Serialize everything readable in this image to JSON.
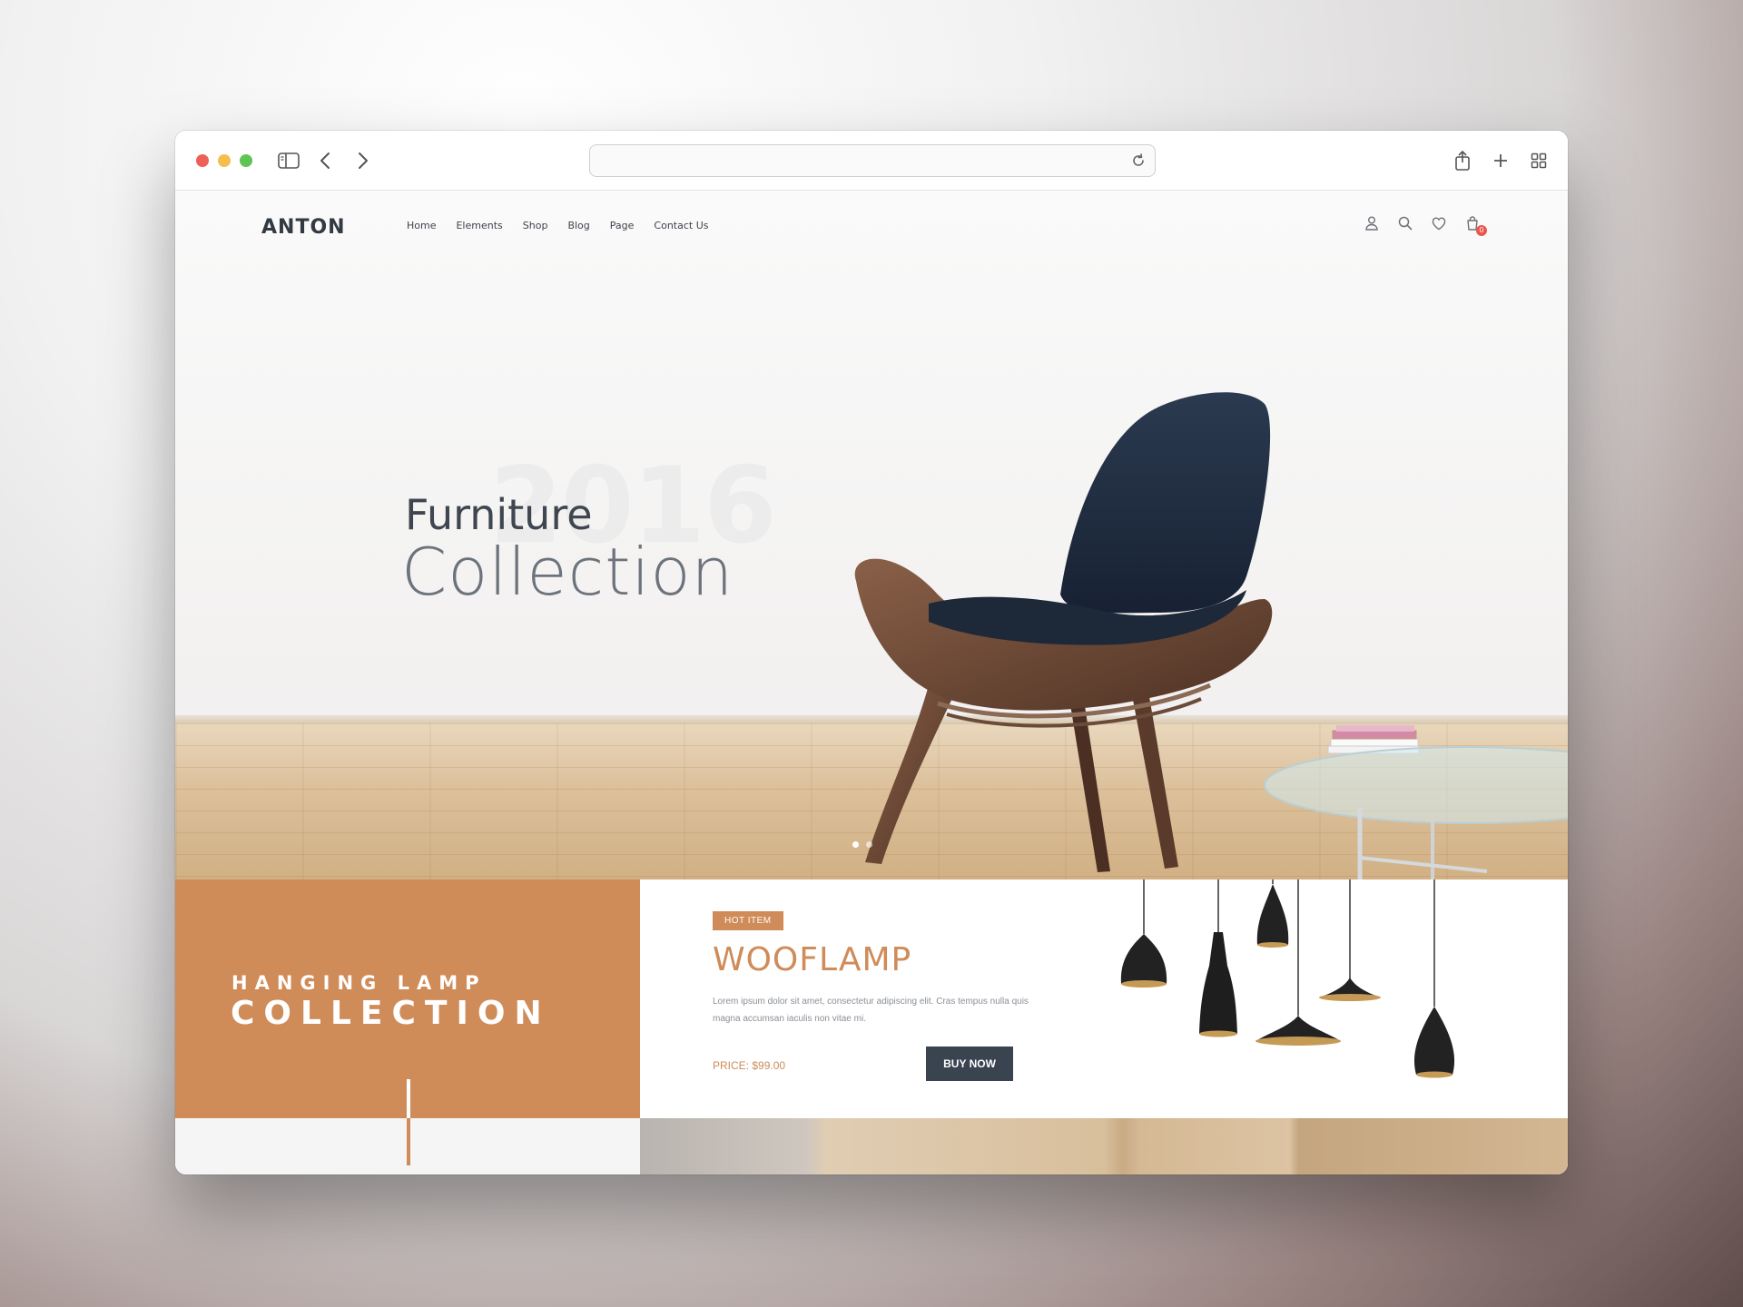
{
  "site": {
    "logo": "ANTON",
    "nav": [
      "Home",
      "Elements",
      "Shop",
      "Blog",
      "Page",
      "Contact Us"
    ],
    "cart_count": "0"
  },
  "hero": {
    "year": "2016",
    "title_line1": "Furniture",
    "title_line2": "Collection"
  },
  "promo": {
    "left_line1": "HANGING LAMP",
    "left_line2": "COLLECTION",
    "badge": "HOT ITEM",
    "product_name": "WOOFLAMP",
    "description": "Lorem ipsum dolor sit amet, consectetur adipiscing elit. Cras tempus nulla quis magna accumsan iaculis non vitae mi.",
    "price": "PRICE: $99.00",
    "buy_label": "BUY NOW"
  },
  "colors": {
    "accent": "#cf8b58",
    "dark_button": "#3a4350",
    "text_dark": "#3f4650"
  },
  "icons": [
    "sidebar-icon",
    "back-icon",
    "forward-icon",
    "reload-icon",
    "share-icon",
    "new-tab-icon",
    "tab-overview-icon",
    "user-icon",
    "search-icon",
    "heart-icon",
    "cart-icon"
  ]
}
